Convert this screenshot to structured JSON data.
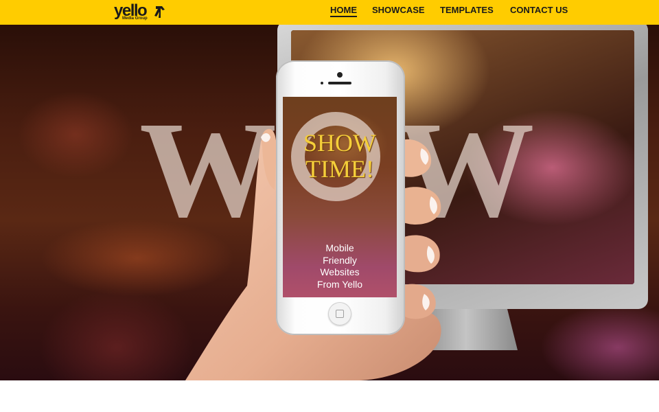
{
  "header": {
    "logo_text": "yello",
    "logo_subtext": "Media Group",
    "logo_icon": "yellow-pages-walking-fingers-icon",
    "background_color": "#ffcc00"
  },
  "nav": {
    "items": [
      {
        "label": "HOME",
        "active": true
      },
      {
        "label": "SHOWCASE",
        "active": false
      },
      {
        "label": "TEMPLATES",
        "active": false
      },
      {
        "label": "CONTACT US",
        "active": false
      }
    ]
  },
  "hero": {
    "background_text": "WOW",
    "phone_screen": {
      "headline": "SHOW TIME!",
      "tagline_lines": [
        "Mobile",
        "Friendly",
        "Websites",
        "From Yello"
      ]
    }
  }
}
